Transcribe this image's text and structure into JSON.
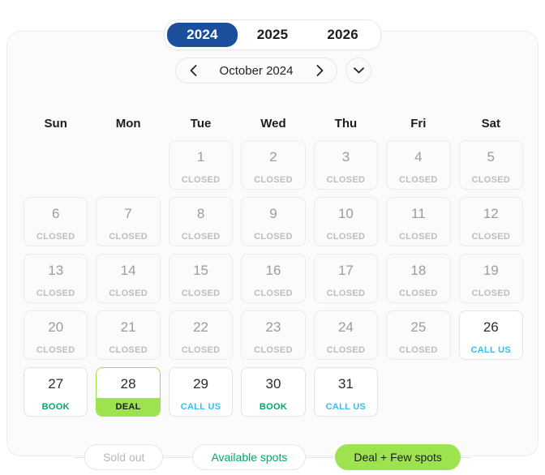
{
  "year_selector": {
    "years": [
      {
        "label": "2024",
        "active": true
      },
      {
        "label": "2025",
        "active": false
      },
      {
        "label": "2026",
        "active": false
      }
    ]
  },
  "month_nav": {
    "prev_icon": "chevron-left-icon",
    "label": "October 2024",
    "next_icon": "chevron-right-icon",
    "expand_icon": "chevron-down-icon"
  },
  "weekdays": [
    "Sun",
    "Mon",
    "Tue",
    "Wed",
    "Thu",
    "Fri",
    "Sat"
  ],
  "calendar": {
    "leading_blanks": 2,
    "days": [
      {
        "day": "1",
        "status": "CLOSED",
        "state": "closed"
      },
      {
        "day": "2",
        "status": "CLOSED",
        "state": "closed"
      },
      {
        "day": "3",
        "status": "CLOSED",
        "state": "closed"
      },
      {
        "day": "4",
        "status": "CLOSED",
        "state": "closed"
      },
      {
        "day": "5",
        "status": "CLOSED",
        "state": "closed"
      },
      {
        "day": "6",
        "status": "CLOSED",
        "state": "closed"
      },
      {
        "day": "7",
        "status": "CLOSED",
        "state": "closed"
      },
      {
        "day": "8",
        "status": "CLOSED",
        "state": "closed"
      },
      {
        "day": "9",
        "status": "CLOSED",
        "state": "closed"
      },
      {
        "day": "10",
        "status": "CLOSED",
        "state": "closed"
      },
      {
        "day": "11",
        "status": "CLOSED",
        "state": "closed"
      },
      {
        "day": "12",
        "status": "CLOSED",
        "state": "closed"
      },
      {
        "day": "13",
        "status": "CLOSED",
        "state": "closed"
      },
      {
        "day": "14",
        "status": "CLOSED",
        "state": "closed"
      },
      {
        "day": "15",
        "status": "CLOSED",
        "state": "closed"
      },
      {
        "day": "16",
        "status": "CLOSED",
        "state": "closed"
      },
      {
        "day": "17",
        "status": "CLOSED",
        "state": "closed"
      },
      {
        "day": "18",
        "status": "CLOSED",
        "state": "closed"
      },
      {
        "day": "19",
        "status": "CLOSED",
        "state": "closed"
      },
      {
        "day": "20",
        "status": "CLOSED",
        "state": "closed"
      },
      {
        "day": "21",
        "status": "CLOSED",
        "state": "closed"
      },
      {
        "day": "22",
        "status": "CLOSED",
        "state": "closed"
      },
      {
        "day": "23",
        "status": "CLOSED",
        "state": "closed"
      },
      {
        "day": "24",
        "status": "CLOSED",
        "state": "closed"
      },
      {
        "day": "25",
        "status": "CLOSED",
        "state": "closed"
      },
      {
        "day": "26",
        "status": "CALL US",
        "state": "callus"
      },
      {
        "day": "27",
        "status": "BOOK",
        "state": "book"
      },
      {
        "day": "28",
        "status": "DEAL",
        "state": "deal"
      },
      {
        "day": "29",
        "status": "CALL US",
        "state": "callus"
      },
      {
        "day": "30",
        "status": "BOOK",
        "state": "book"
      },
      {
        "day": "31",
        "status": "CALL US",
        "state": "callus"
      }
    ]
  },
  "legend": [
    {
      "label": "Sold out",
      "variant": "soldout"
    },
    {
      "label": "Available spots",
      "variant": "available"
    },
    {
      "label": "Deal + Few spots",
      "variant": "deal"
    }
  ],
  "colors": {
    "year_active_bg": "#1b4f9c",
    "deal_green": "#9de24f",
    "book_green": "#00a86b",
    "callus_blue": "#35bdf2",
    "closed_gray": "#bcbcc4"
  }
}
